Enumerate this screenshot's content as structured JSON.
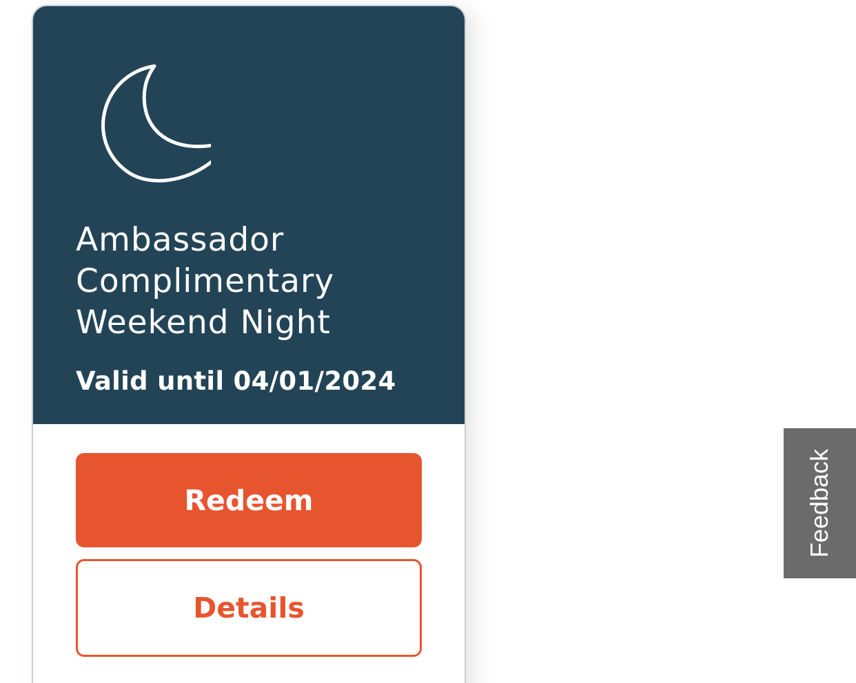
{
  "offer": {
    "icon": "moon-icon",
    "title_lines": [
      "Ambassador",
      "Complimentary",
      "Weekend Night"
    ],
    "validity": "Valid until 04/01/2024",
    "redeem_label": "Redeem",
    "details_label": "Details"
  },
  "feedback": {
    "label": "Feedback"
  },
  "colors": {
    "card_header": "#224456",
    "accent": "#e7552f",
    "feedback_tab": "#6b6b6b"
  }
}
